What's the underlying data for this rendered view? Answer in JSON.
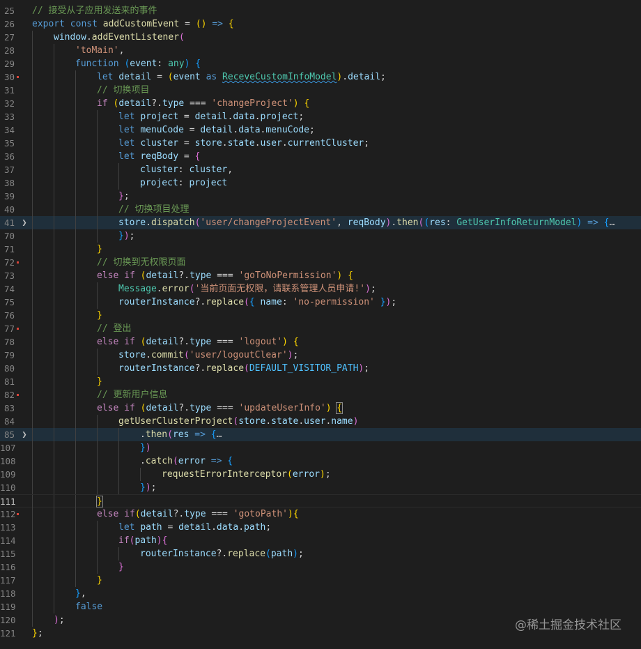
{
  "watermark": "@稀土掘金技术社区",
  "colors": {
    "background": "#1e1e1e",
    "comment": "#6a9955",
    "keyword": "#569cd6",
    "string": "#ce9178",
    "function": "#dcdcaa",
    "variable": "#9cdcfe",
    "type": "#4ec9b0",
    "highlight_line": "#1f2f3b",
    "modified_marker": "#d8453a"
  },
  "lines": [
    {
      "n": "25",
      "i": 0,
      "tokens": [
        [
          "cm",
          "// 接受从子应用发送来的事件"
        ]
      ]
    },
    {
      "n": "26",
      "i": 0,
      "tokens": [
        [
          "kw",
          "export"
        ],
        [
          "op",
          " "
        ],
        [
          "kw",
          "const"
        ],
        [
          "op",
          " "
        ],
        [
          "fn",
          "addCustomEvent"
        ],
        [
          "op",
          " = "
        ],
        [
          "b1",
          "("
        ],
        [
          "b1",
          ")"
        ],
        [
          "op",
          " "
        ],
        [
          "kw",
          "=>"
        ],
        [
          "op",
          " "
        ],
        [
          "b1",
          "{"
        ]
      ]
    },
    {
      "n": "27",
      "i": 1,
      "tokens": [
        [
          "vr",
          "window"
        ],
        [
          "pn",
          "."
        ],
        [
          "fn",
          "addEventListener"
        ],
        [
          "b2",
          "("
        ]
      ]
    },
    {
      "n": "28",
      "i": 2,
      "tokens": [
        [
          "st",
          "'toMain'"
        ],
        [
          "pn",
          ","
        ]
      ]
    },
    {
      "n": "29",
      "i": 2,
      "tokens": [
        [
          "kw",
          "function"
        ],
        [
          "op",
          " "
        ],
        [
          "b3",
          "("
        ],
        [
          "vr",
          "event"
        ],
        [
          "pn",
          ": "
        ],
        [
          "tp",
          "any"
        ],
        [
          "b3",
          ")"
        ],
        [
          "op",
          " "
        ],
        [
          "b3",
          "{"
        ]
      ]
    },
    {
      "n": "30",
      "i": 3,
      "mark": true,
      "tokens": [
        [
          "kw",
          "let"
        ],
        [
          "op",
          " "
        ],
        [
          "vr",
          "detail"
        ],
        [
          "op",
          " = "
        ],
        [
          "b1",
          "("
        ],
        [
          "vr",
          "event"
        ],
        [
          "op",
          " "
        ],
        [
          "kw",
          "as"
        ],
        [
          "op",
          " "
        ],
        [
          "sq",
          "ReceveCustomInfoModel"
        ],
        [
          "b1",
          ")"
        ],
        [
          "pn",
          "."
        ],
        [
          "vr",
          "detail"
        ],
        [
          "pn",
          ";"
        ]
      ]
    },
    {
      "n": "31",
      "i": 3,
      "tokens": [
        [
          "cm",
          "// 切换项目"
        ]
      ]
    },
    {
      "n": "32",
      "i": 3,
      "tokens": [
        [
          "ct",
          "if"
        ],
        [
          "op",
          " "
        ],
        [
          "b1",
          "("
        ],
        [
          "vr",
          "detail"
        ],
        [
          "op",
          "?."
        ],
        [
          "vr",
          "type"
        ],
        [
          "op",
          " === "
        ],
        [
          "st",
          "'changeProject'"
        ],
        [
          "b1",
          ")"
        ],
        [
          "op",
          " "
        ],
        [
          "b1",
          "{"
        ]
      ]
    },
    {
      "n": "33",
      "i": 4,
      "tokens": [
        [
          "kw",
          "let"
        ],
        [
          "op",
          " "
        ],
        [
          "vr",
          "project"
        ],
        [
          "op",
          " = "
        ],
        [
          "vr",
          "detail"
        ],
        [
          "pn",
          "."
        ],
        [
          "vr",
          "data"
        ],
        [
          "pn",
          "."
        ],
        [
          "vr",
          "project"
        ],
        [
          "pn",
          ";"
        ]
      ]
    },
    {
      "n": "34",
      "i": 4,
      "tokens": [
        [
          "kw",
          "let"
        ],
        [
          "op",
          " "
        ],
        [
          "vr",
          "menuCode"
        ],
        [
          "op",
          " = "
        ],
        [
          "vr",
          "detail"
        ],
        [
          "pn",
          "."
        ],
        [
          "vr",
          "data"
        ],
        [
          "pn",
          "."
        ],
        [
          "vr",
          "menuCode"
        ],
        [
          "pn",
          ";"
        ]
      ]
    },
    {
      "n": "35",
      "i": 4,
      "tokens": [
        [
          "kw",
          "let"
        ],
        [
          "op",
          " "
        ],
        [
          "vr",
          "cluster"
        ],
        [
          "op",
          " = "
        ],
        [
          "vr",
          "store"
        ],
        [
          "pn",
          "."
        ],
        [
          "vr",
          "state"
        ],
        [
          "pn",
          "."
        ],
        [
          "vr",
          "user"
        ],
        [
          "pn",
          "."
        ],
        [
          "vr",
          "currentCluster"
        ],
        [
          "pn",
          ";"
        ]
      ]
    },
    {
      "n": "36",
      "i": 4,
      "tokens": [
        [
          "kw",
          "let"
        ],
        [
          "op",
          " "
        ],
        [
          "vr",
          "reqBody"
        ],
        [
          "op",
          " = "
        ],
        [
          "b2",
          "{"
        ]
      ]
    },
    {
      "n": "37",
      "i": 5,
      "tokens": [
        [
          "vr",
          "cluster"
        ],
        [
          "pn",
          ": "
        ],
        [
          "vr",
          "cluster"
        ],
        [
          "pn",
          ","
        ]
      ]
    },
    {
      "n": "38",
      "i": 5,
      "tokens": [
        [
          "vr",
          "project"
        ],
        [
          "pn",
          ": "
        ],
        [
          "vr",
          "project"
        ]
      ]
    },
    {
      "n": "39",
      "i": 4,
      "tokens": [
        [
          "b2",
          "}"
        ],
        [
          "pn",
          ";"
        ]
      ]
    },
    {
      "n": "40",
      "i": 4,
      "tokens": [
        [
          "cm",
          "// 切换项目处理"
        ]
      ]
    },
    {
      "n": "41",
      "i": 4,
      "fold": true,
      "hl": true,
      "tokens": [
        [
          "vr",
          "store"
        ],
        [
          "pn",
          "."
        ],
        [
          "fn",
          "dispatch"
        ],
        [
          "b2",
          "("
        ],
        [
          "st",
          "'user/changeProjectEvent'"
        ],
        [
          "pn",
          ", "
        ],
        [
          "vr",
          "reqBody"
        ],
        [
          "b2",
          ")"
        ],
        [
          "pn",
          "."
        ],
        [
          "fn",
          "then"
        ],
        [
          "b2",
          "("
        ],
        [
          "b3",
          "("
        ],
        [
          "vr",
          "res"
        ],
        [
          "pn",
          ": "
        ],
        [
          "tp",
          "GetUserInfoReturnModel"
        ],
        [
          "b3",
          ")"
        ],
        [
          "op",
          " "
        ],
        [
          "kw",
          "=>"
        ],
        [
          "op",
          " "
        ],
        [
          "b3",
          "{"
        ],
        [
          "el",
          "…"
        ]
      ]
    },
    {
      "n": "70",
      "i": 4,
      "tokens": [
        [
          "b3",
          "}"
        ],
        [
          "b2",
          ")"
        ],
        [
          "pn",
          ";"
        ]
      ]
    },
    {
      "n": "71",
      "i": 3,
      "tokens": [
        [
          "b1",
          "}"
        ]
      ]
    },
    {
      "n": "72",
      "i": 3,
      "mark": true,
      "tokens": [
        [
          "cm",
          "// 切换到无权限页面"
        ]
      ]
    },
    {
      "n": "73",
      "i": 3,
      "tokens": [
        [
          "ct",
          "else"
        ],
        [
          "op",
          " "
        ],
        [
          "ct",
          "if"
        ],
        [
          "op",
          " "
        ],
        [
          "b1",
          "("
        ],
        [
          "vr",
          "detail"
        ],
        [
          "op",
          "?."
        ],
        [
          "vr",
          "type"
        ],
        [
          "op",
          " === "
        ],
        [
          "st",
          "'goToNoPermission'"
        ],
        [
          "b1",
          ")"
        ],
        [
          "op",
          " "
        ],
        [
          "b1",
          "{"
        ]
      ]
    },
    {
      "n": "74",
      "i": 4,
      "tokens": [
        [
          "tp",
          "Message"
        ],
        [
          "pn",
          "."
        ],
        [
          "fn",
          "error"
        ],
        [
          "b2",
          "("
        ],
        [
          "st",
          "'当前页面无权限，请联系管理人员申请!'"
        ],
        [
          "b2",
          ")"
        ],
        [
          "pn",
          ";"
        ]
      ]
    },
    {
      "n": "75",
      "i": 4,
      "tokens": [
        [
          "vr",
          "routerInstance"
        ],
        [
          "op",
          "?."
        ],
        [
          "fn",
          "replace"
        ],
        [
          "b2",
          "("
        ],
        [
          "b3",
          "{"
        ],
        [
          "op",
          " "
        ],
        [
          "vr",
          "name"
        ],
        [
          "pn",
          ": "
        ],
        [
          "st",
          "'no-permission'"
        ],
        [
          "op",
          " "
        ],
        [
          "b3",
          "}"
        ],
        [
          "b2",
          ")"
        ],
        [
          "pn",
          ";"
        ]
      ]
    },
    {
      "n": "76",
      "i": 3,
      "tokens": [
        [
          "b1",
          "}"
        ]
      ]
    },
    {
      "n": "77",
      "i": 3,
      "mark": true,
      "tokens": [
        [
          "cm",
          "// 登出"
        ]
      ]
    },
    {
      "n": "78",
      "i": 3,
      "tokens": [
        [
          "ct",
          "else"
        ],
        [
          "op",
          " "
        ],
        [
          "ct",
          "if"
        ],
        [
          "op",
          " "
        ],
        [
          "b1",
          "("
        ],
        [
          "vr",
          "detail"
        ],
        [
          "op",
          "?."
        ],
        [
          "vr",
          "type"
        ],
        [
          "op",
          " === "
        ],
        [
          "st",
          "'logout'"
        ],
        [
          "b1",
          ")"
        ],
        [
          "op",
          " "
        ],
        [
          "b1",
          "{"
        ]
      ]
    },
    {
      "n": "79",
      "i": 4,
      "tokens": [
        [
          "vr",
          "store"
        ],
        [
          "pn",
          "."
        ],
        [
          "fn",
          "commit"
        ],
        [
          "b2",
          "("
        ],
        [
          "st",
          "'user/logoutClear'"
        ],
        [
          "b2",
          ")"
        ],
        [
          "pn",
          ";"
        ]
      ]
    },
    {
      "n": "80",
      "i": 4,
      "tokens": [
        [
          "vr",
          "routerInstance"
        ],
        [
          "op",
          "?."
        ],
        [
          "fn",
          "replace"
        ],
        [
          "b2",
          "("
        ],
        [
          "cn",
          "DEFAULT_VISITOR_PATH"
        ],
        [
          "b2",
          ")"
        ],
        [
          "pn",
          ";"
        ]
      ]
    },
    {
      "n": "81",
      "i": 3,
      "tokens": [
        [
          "b1",
          "}"
        ]
      ]
    },
    {
      "n": "82",
      "i": 3,
      "mark": true,
      "tokens": [
        [
          "cm",
          "// 更新用户信息"
        ]
      ]
    },
    {
      "n": "83",
      "i": 3,
      "tokens": [
        [
          "ct",
          "else"
        ],
        [
          "op",
          " "
        ],
        [
          "ct",
          "if"
        ],
        [
          "op",
          " "
        ],
        [
          "b1",
          "("
        ],
        [
          "vr",
          "detail"
        ],
        [
          "op",
          "?."
        ],
        [
          "vr",
          "type"
        ],
        [
          "op",
          " === "
        ],
        [
          "st",
          "'updateUserInfo'"
        ],
        [
          "b1",
          ")"
        ],
        [
          "op",
          " "
        ],
        [
          "bx",
          "{"
        ]
      ]
    },
    {
      "n": "84",
      "i": 4,
      "tokens": [
        [
          "fn",
          "getUserClusterProject"
        ],
        [
          "b2",
          "("
        ],
        [
          "vr",
          "store"
        ],
        [
          "pn",
          "."
        ],
        [
          "vr",
          "state"
        ],
        [
          "pn",
          "."
        ],
        [
          "vr",
          "user"
        ],
        [
          "pn",
          "."
        ],
        [
          "vr",
          "name"
        ],
        [
          "b2",
          ")"
        ]
      ]
    },
    {
      "n": "85",
      "i": 5,
      "fold": true,
      "hl": true,
      "tokens": [
        [
          "pn",
          "."
        ],
        [
          "fn",
          "then"
        ],
        [
          "b2",
          "("
        ],
        [
          "vr",
          "res"
        ],
        [
          "op",
          " "
        ],
        [
          "kw",
          "=>"
        ],
        [
          "op",
          " "
        ],
        [
          "b3",
          "{"
        ],
        [
          "el",
          "…"
        ]
      ]
    },
    {
      "n": "107",
      "i": 5,
      "tokens": [
        [
          "b3",
          "}"
        ],
        [
          "b2",
          ")"
        ]
      ]
    },
    {
      "n": "108",
      "i": 5,
      "tokens": [
        [
          "pn",
          "."
        ],
        [
          "fn",
          "catch"
        ],
        [
          "b2",
          "("
        ],
        [
          "vr",
          "error"
        ],
        [
          "op",
          " "
        ],
        [
          "kw",
          "=>"
        ],
        [
          "op",
          " "
        ],
        [
          "b3",
          "{"
        ]
      ]
    },
    {
      "n": "109",
      "i": 6,
      "tokens": [
        [
          "fn",
          "requestErrorInterceptor"
        ],
        [
          "b1",
          "("
        ],
        [
          "vr",
          "error"
        ],
        [
          "b1",
          ")"
        ],
        [
          "pn",
          ";"
        ]
      ]
    },
    {
      "n": "110",
      "i": 5,
      "tokens": [
        [
          "b3",
          "}"
        ],
        [
          "b2",
          ")"
        ],
        [
          "pn",
          ";"
        ]
      ]
    },
    {
      "n": "111",
      "i": 3,
      "cur": true,
      "tokens": [
        [
          "bx",
          "}"
        ]
      ]
    },
    {
      "n": "112",
      "i": 3,
      "mark": true,
      "tokens": [
        [
          "ct",
          "else"
        ],
        [
          "op",
          " "
        ],
        [
          "ct",
          "if"
        ],
        [
          "b1",
          "("
        ],
        [
          "vr",
          "detail"
        ],
        [
          "op",
          "?."
        ],
        [
          "vr",
          "type"
        ],
        [
          "op",
          " === "
        ],
        [
          "st",
          "'gotoPath'"
        ],
        [
          "b1",
          ")"
        ],
        [
          "b1",
          "{"
        ]
      ]
    },
    {
      "n": "113",
      "i": 4,
      "tokens": [
        [
          "kw",
          "let"
        ],
        [
          "op",
          " "
        ],
        [
          "vr",
          "path"
        ],
        [
          "op",
          " = "
        ],
        [
          "vr",
          "detail"
        ],
        [
          "pn",
          "."
        ],
        [
          "vr",
          "data"
        ],
        [
          "pn",
          "."
        ],
        [
          "vr",
          "path"
        ],
        [
          "pn",
          ";"
        ]
      ]
    },
    {
      "n": "114",
      "i": 4,
      "tokens": [
        [
          "ct",
          "if"
        ],
        [
          "b2",
          "("
        ],
        [
          "vr",
          "path"
        ],
        [
          "b2",
          ")"
        ],
        [
          "b2",
          "{"
        ]
      ]
    },
    {
      "n": "115",
      "i": 5,
      "tokens": [
        [
          "vr",
          "routerInstance"
        ],
        [
          "op",
          "?."
        ],
        [
          "fn",
          "replace"
        ],
        [
          "b3",
          "("
        ],
        [
          "vr",
          "path"
        ],
        [
          "b3",
          ")"
        ],
        [
          "pn",
          ";"
        ]
      ]
    },
    {
      "n": "116",
      "i": 4,
      "tokens": [
        [
          "b2",
          "}"
        ]
      ]
    },
    {
      "n": "117",
      "i": 3,
      "tokens": [
        [
          "b1",
          "}"
        ]
      ]
    },
    {
      "n": "118",
      "i": 2,
      "tokens": [
        [
          "b3",
          "}"
        ],
        [
          "pn",
          ","
        ]
      ]
    },
    {
      "n": "119",
      "i": 2,
      "tokens": [
        [
          "kw",
          "false"
        ]
      ]
    },
    {
      "n": "120",
      "i": 1,
      "tokens": [
        [
          "b2",
          ")"
        ],
        [
          "pn",
          ";"
        ]
      ]
    },
    {
      "n": "121",
      "i": 0,
      "tokens": [
        [
          "b1",
          "}"
        ],
        [
          "pn",
          ";"
        ]
      ]
    }
  ]
}
